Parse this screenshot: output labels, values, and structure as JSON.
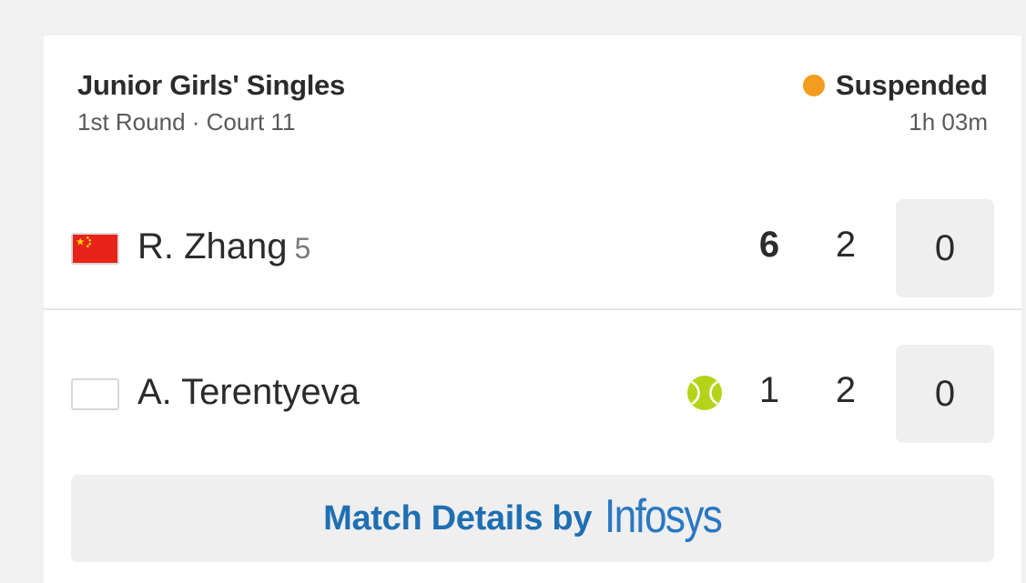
{
  "match": {
    "event": "Junior Girls' Singles",
    "round_court": "1st Round · Court 11",
    "status": "Suspended",
    "duration": "1h 03m",
    "status_color": "#f39c1f"
  },
  "players": [
    {
      "name": "R. Zhang",
      "seed": "5",
      "flag": "china-flag-icon",
      "serving": false,
      "set1": "6",
      "set2": "2",
      "game": "0"
    },
    {
      "name": "A. Terentyeva",
      "seed": "",
      "flag": "blank-flag-icon",
      "serving": true,
      "set1": "1",
      "set2": "2",
      "game": "0"
    }
  ],
  "footer": {
    "details_label": "Match Details by",
    "sponsor": "Infosys"
  },
  "colors": {
    "accent": "#1f6fb3",
    "serve_ball": "#b5d319"
  }
}
